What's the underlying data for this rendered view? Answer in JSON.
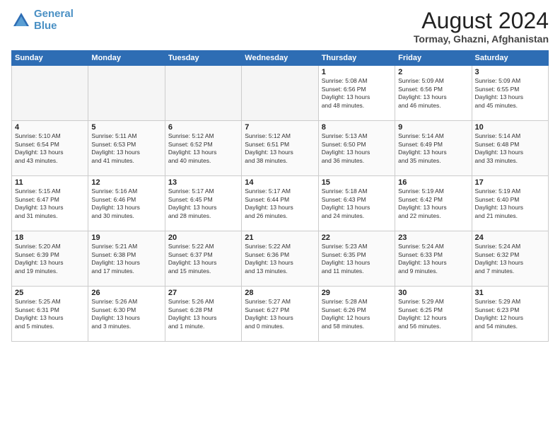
{
  "logo": {
    "line1": "General",
    "line2": "Blue"
  },
  "title": "August 2024",
  "location": "Tormay, Ghazni, Afghanistan",
  "days_of_week": [
    "Sunday",
    "Monday",
    "Tuesday",
    "Wednesday",
    "Thursday",
    "Friday",
    "Saturday"
  ],
  "weeks": [
    [
      {
        "day": "",
        "content": ""
      },
      {
        "day": "",
        "content": ""
      },
      {
        "day": "",
        "content": ""
      },
      {
        "day": "",
        "content": ""
      },
      {
        "day": "1",
        "content": "Sunrise: 5:08 AM\nSunset: 6:56 PM\nDaylight: 13 hours\nand 48 minutes."
      },
      {
        "day": "2",
        "content": "Sunrise: 5:09 AM\nSunset: 6:56 PM\nDaylight: 13 hours\nand 46 minutes."
      },
      {
        "day": "3",
        "content": "Sunrise: 5:09 AM\nSunset: 6:55 PM\nDaylight: 13 hours\nand 45 minutes."
      }
    ],
    [
      {
        "day": "4",
        "content": "Sunrise: 5:10 AM\nSunset: 6:54 PM\nDaylight: 13 hours\nand 43 minutes."
      },
      {
        "day": "5",
        "content": "Sunrise: 5:11 AM\nSunset: 6:53 PM\nDaylight: 13 hours\nand 41 minutes."
      },
      {
        "day": "6",
        "content": "Sunrise: 5:12 AM\nSunset: 6:52 PM\nDaylight: 13 hours\nand 40 minutes."
      },
      {
        "day": "7",
        "content": "Sunrise: 5:12 AM\nSunset: 6:51 PM\nDaylight: 13 hours\nand 38 minutes."
      },
      {
        "day": "8",
        "content": "Sunrise: 5:13 AM\nSunset: 6:50 PM\nDaylight: 13 hours\nand 36 minutes."
      },
      {
        "day": "9",
        "content": "Sunrise: 5:14 AM\nSunset: 6:49 PM\nDaylight: 13 hours\nand 35 minutes."
      },
      {
        "day": "10",
        "content": "Sunrise: 5:14 AM\nSunset: 6:48 PM\nDaylight: 13 hours\nand 33 minutes."
      }
    ],
    [
      {
        "day": "11",
        "content": "Sunrise: 5:15 AM\nSunset: 6:47 PM\nDaylight: 13 hours\nand 31 minutes."
      },
      {
        "day": "12",
        "content": "Sunrise: 5:16 AM\nSunset: 6:46 PM\nDaylight: 13 hours\nand 30 minutes."
      },
      {
        "day": "13",
        "content": "Sunrise: 5:17 AM\nSunset: 6:45 PM\nDaylight: 13 hours\nand 28 minutes."
      },
      {
        "day": "14",
        "content": "Sunrise: 5:17 AM\nSunset: 6:44 PM\nDaylight: 13 hours\nand 26 minutes."
      },
      {
        "day": "15",
        "content": "Sunrise: 5:18 AM\nSunset: 6:43 PM\nDaylight: 13 hours\nand 24 minutes."
      },
      {
        "day": "16",
        "content": "Sunrise: 5:19 AM\nSunset: 6:42 PM\nDaylight: 13 hours\nand 22 minutes."
      },
      {
        "day": "17",
        "content": "Sunrise: 5:19 AM\nSunset: 6:40 PM\nDaylight: 13 hours\nand 21 minutes."
      }
    ],
    [
      {
        "day": "18",
        "content": "Sunrise: 5:20 AM\nSunset: 6:39 PM\nDaylight: 13 hours\nand 19 minutes."
      },
      {
        "day": "19",
        "content": "Sunrise: 5:21 AM\nSunset: 6:38 PM\nDaylight: 13 hours\nand 17 minutes."
      },
      {
        "day": "20",
        "content": "Sunrise: 5:22 AM\nSunset: 6:37 PM\nDaylight: 13 hours\nand 15 minutes."
      },
      {
        "day": "21",
        "content": "Sunrise: 5:22 AM\nSunset: 6:36 PM\nDaylight: 13 hours\nand 13 minutes."
      },
      {
        "day": "22",
        "content": "Sunrise: 5:23 AM\nSunset: 6:35 PM\nDaylight: 13 hours\nand 11 minutes."
      },
      {
        "day": "23",
        "content": "Sunrise: 5:24 AM\nSunset: 6:33 PM\nDaylight: 13 hours\nand 9 minutes."
      },
      {
        "day": "24",
        "content": "Sunrise: 5:24 AM\nSunset: 6:32 PM\nDaylight: 13 hours\nand 7 minutes."
      }
    ],
    [
      {
        "day": "25",
        "content": "Sunrise: 5:25 AM\nSunset: 6:31 PM\nDaylight: 13 hours\nand 5 minutes."
      },
      {
        "day": "26",
        "content": "Sunrise: 5:26 AM\nSunset: 6:30 PM\nDaylight: 13 hours\nand 3 minutes."
      },
      {
        "day": "27",
        "content": "Sunrise: 5:26 AM\nSunset: 6:28 PM\nDaylight: 13 hours\nand 1 minute."
      },
      {
        "day": "28",
        "content": "Sunrise: 5:27 AM\nSunset: 6:27 PM\nDaylight: 13 hours\nand 0 minutes."
      },
      {
        "day": "29",
        "content": "Sunrise: 5:28 AM\nSunset: 6:26 PM\nDaylight: 12 hours\nand 58 minutes."
      },
      {
        "day": "30",
        "content": "Sunrise: 5:29 AM\nSunset: 6:25 PM\nDaylight: 12 hours\nand 56 minutes."
      },
      {
        "day": "31",
        "content": "Sunrise: 5:29 AM\nSunset: 6:23 PM\nDaylight: 12 hours\nand 54 minutes."
      }
    ]
  ]
}
